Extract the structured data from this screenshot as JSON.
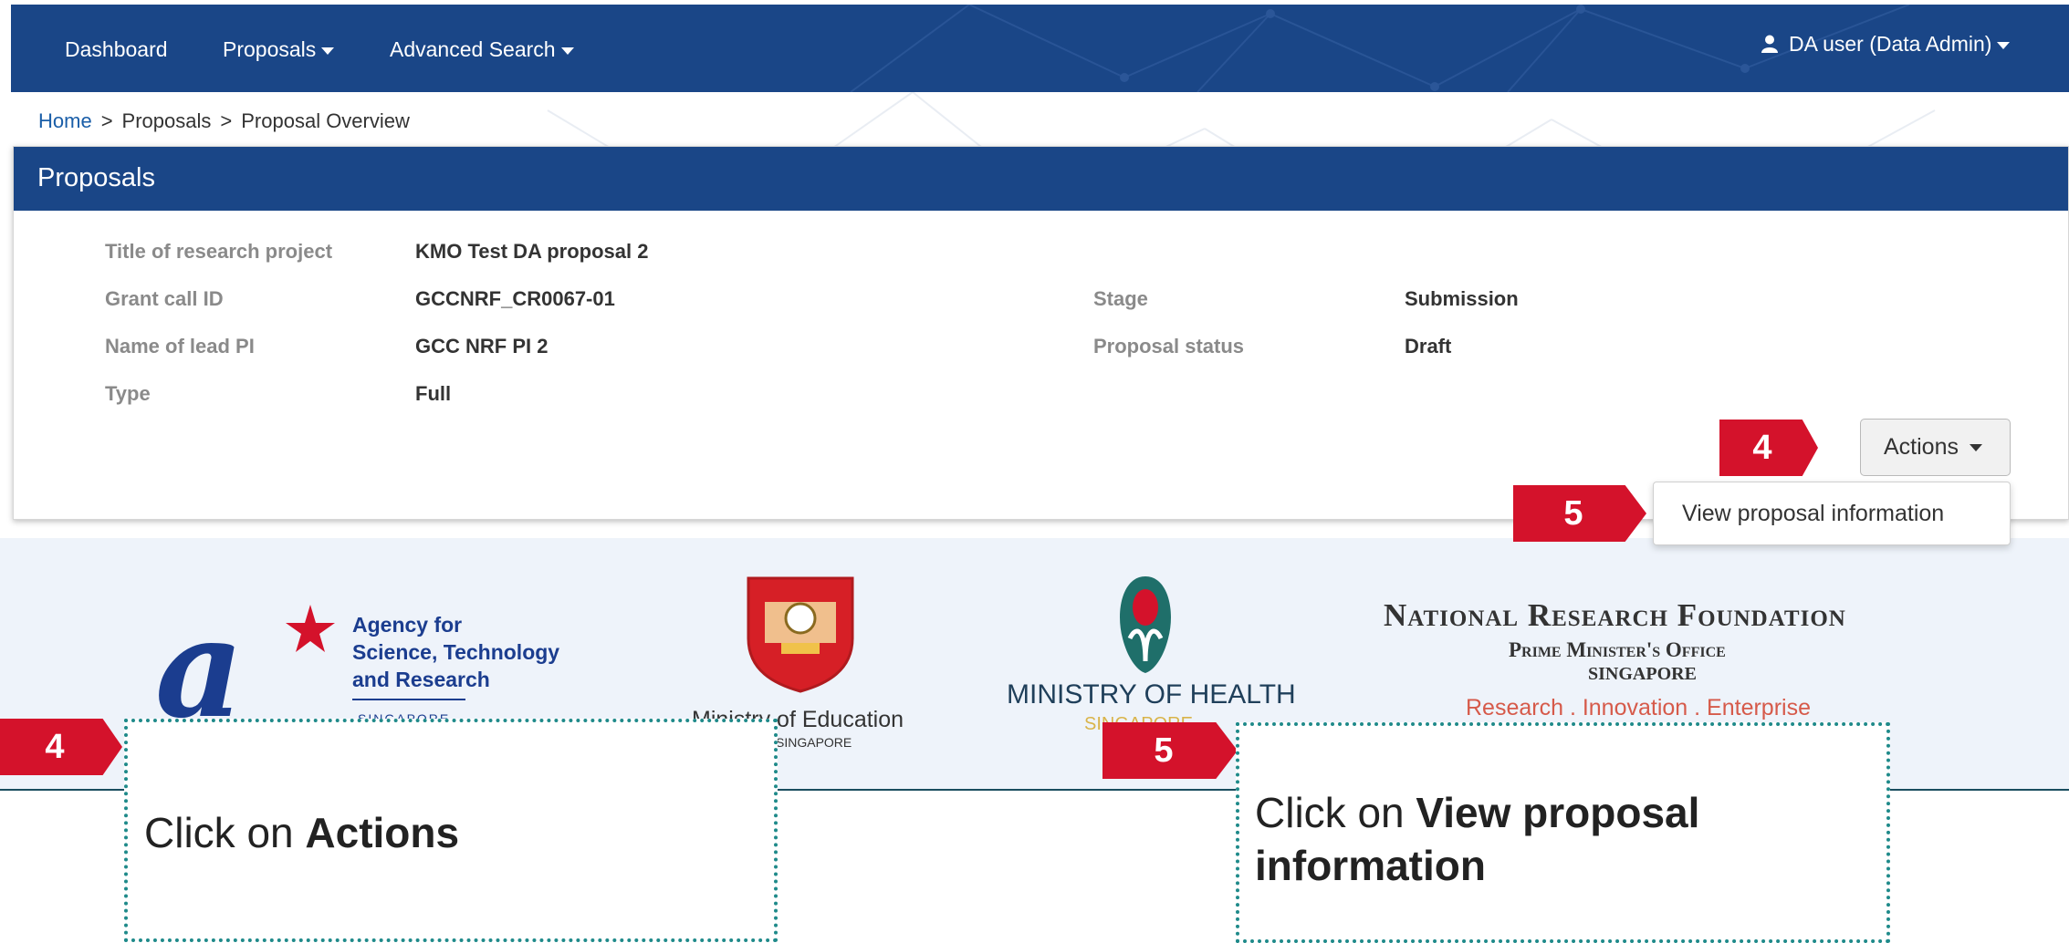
{
  "navbar": {
    "items": [
      "Dashboard",
      "Proposals",
      "Advanced Search"
    ],
    "user": "DA user (Data Admin)"
  },
  "breadcrumb": {
    "home": "Home",
    "sep": ">",
    "proposals": "Proposals",
    "current": "Proposal Overview"
  },
  "panel": {
    "title": "Proposals",
    "fields": {
      "title_label": "Title of research project",
      "title_value": "KMO Test DA proposal 2",
      "grant_label": "Grant call ID",
      "grant_value": "GCCNRF_CR0067-01",
      "pi_label": "Name of lead PI",
      "pi_value": "GCC NRF PI 2",
      "type_label": "Type",
      "type_value": "Full",
      "stage_label": "Stage",
      "stage_value": "Submission",
      "status_label": "Proposal status",
      "status_value": "Draft"
    },
    "actions_label": "Actions",
    "dropdown_item": "View proposal information"
  },
  "markers": {
    "four": "4",
    "five": "5"
  },
  "logos": {
    "astar": {
      "line1": "Agency for",
      "line2": "Science, Technology",
      "line3": "and Research",
      "line4": "SINGAPORE"
    },
    "moe": {
      "name": "Ministry of Education",
      "country": "SINGAPORE"
    },
    "moh": {
      "name": "MINISTRY OF HEALTH",
      "country": "SINGAPORE"
    },
    "nrf": {
      "name": "National Research Foundation",
      "office": "Prime Minister's Office",
      "country": "SINGAPORE",
      "tagline": "Research . Innovation . Enterprise"
    }
  },
  "callouts": {
    "actions": {
      "prefix": "Click on ",
      "bold": "Actions"
    },
    "view": {
      "prefix": "Click on ",
      "bold": "View proposal information"
    }
  },
  "colors": {
    "navy": "#1a4687",
    "marker_red": "#d4122b",
    "callout_border": "#1f8a8a"
  }
}
